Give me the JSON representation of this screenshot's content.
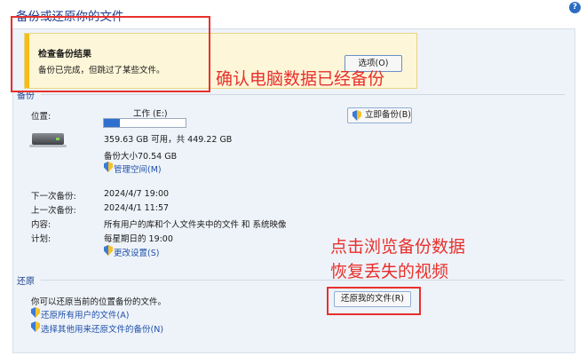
{
  "window": {
    "title": "备份或还原你的文件",
    "help": "?"
  },
  "notice": {
    "title": "检查备份结果",
    "text": "备份已完成，但跳过了某些文件。",
    "options_label": "选项(O)"
  },
  "backup": {
    "section_label": "备份",
    "location_label": "位置:",
    "drive_name": "工作 (E:)",
    "drive_usage": 0.2,
    "free_space": "359.63 GB 可用，共 449.22 GB",
    "backup_size": "备份大小70.54 GB",
    "manage_space": "管理空间(M)",
    "backup_now": "立即备份(B)",
    "next_label": "下一次备份:",
    "next_value": "2024/4/7 19:00",
    "last_label": "上一次备份:",
    "last_value": "2024/4/1 11:57",
    "contents_label": "内容:",
    "contents_value": "所有用户的库和个人文件夹中的文件 和 系统映像",
    "schedule_label": "计划:",
    "schedule_value": "每星期日的 19:00",
    "change_settings": "更改设置(S)"
  },
  "restore": {
    "section_label": "还原",
    "description": "你可以还原当前的位置备份的文件。",
    "restore_all_users": "还原所有用户的文件(A)",
    "select_other": "选择其他用来还原文件的备份(N)",
    "restore_my_files": "还原我的文件(R)"
  },
  "annotations": {
    "confirm": "确认电脑数据已经备份",
    "line1": "点击浏览备份数据",
    "line2": "恢复丢失的视频",
    "color": "#e8302c"
  },
  "colors": {
    "accent": "#2f6fcf",
    "title": "#1e3f8c",
    "notice_bar": "#f6bd16"
  }
}
